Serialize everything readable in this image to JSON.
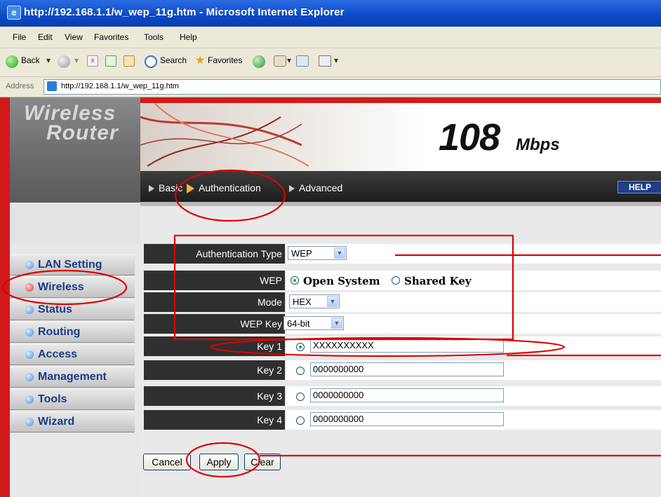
{
  "window": {
    "title": "http://192.168.1.1/w_wep_11g.htm - Microsoft Internet Explorer"
  },
  "menu": [
    "File",
    "Edit",
    "View",
    "Favorites",
    "Tools",
    "Help"
  ],
  "toolbar": {
    "back": "Back",
    "search": "Search",
    "favorites": "Favorites"
  },
  "address": {
    "label": "Address",
    "url": "http://192.168.1.1/w_wep_11g.htm"
  },
  "brand": {
    "line1": "Wireless",
    "line2": "Router",
    "speed": "108",
    "unit": "Mbps"
  },
  "sidebar": {
    "items": [
      {
        "label": "LAN Setting"
      },
      {
        "label": "Wireless"
      },
      {
        "label": "Status"
      },
      {
        "label": "Routing"
      },
      {
        "label": "Access"
      },
      {
        "label": "Management"
      },
      {
        "label": "Tools"
      },
      {
        "label": "Wizard"
      }
    ],
    "active": "Wireless"
  },
  "subnav": {
    "items": [
      "Basic",
      "Authentication",
      "Advanced"
    ],
    "active": "Authentication",
    "help": "HELP"
  },
  "form": {
    "auth_type_label": "Authentication Type",
    "auth_type_value": "WEP",
    "wep_label": "WEP",
    "wep_options": [
      "Open System",
      "Shared Key"
    ],
    "wep_selected": "Open System",
    "mode_label": "Mode",
    "mode_value": "HEX",
    "wepkey_label": "WEP Key",
    "wepkey_value": "64-bit",
    "keys": [
      {
        "label": "Key 1",
        "value": "XXXXXXXXXX",
        "selected": true
      },
      {
        "label": "Key 2",
        "value": "0000000000",
        "selected": false
      },
      {
        "label": "Key 3",
        "value": "0000000000",
        "selected": false
      },
      {
        "label": "Key 4",
        "value": "0000000000",
        "selected": false
      }
    ]
  },
  "buttons": {
    "cancel": "Cancel",
    "apply": "Apply",
    "clear": "Clear"
  },
  "colors": {
    "annotation": "#e00000",
    "brand_red": "#d21a1a",
    "active_tab": "#f3b43a"
  }
}
